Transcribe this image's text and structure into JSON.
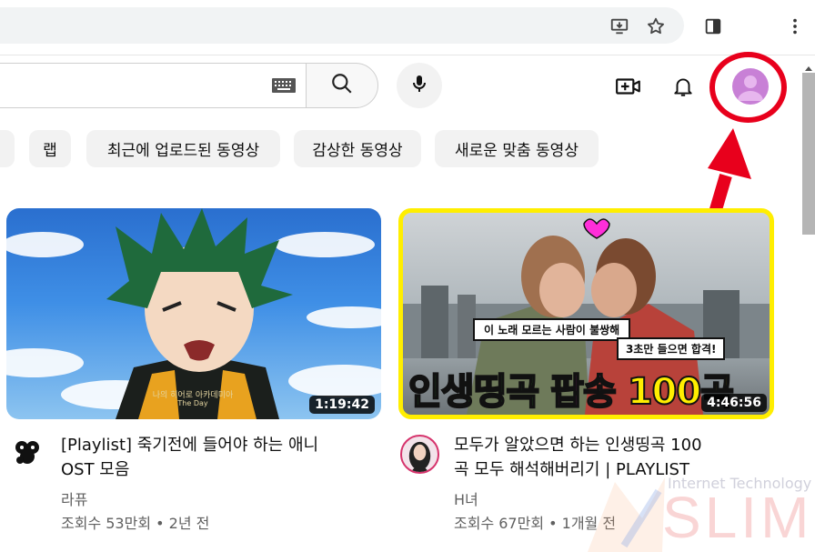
{
  "colors": {
    "annotation_red": "#e8001c",
    "chip_bg": "#f2f2f2",
    "meta_gray": "#606060",
    "thumb2_border": "#ffee00"
  },
  "browser": {
    "icons": [
      "install-app-icon",
      "bookmark-star-icon",
      "side-panel-icon",
      "more-vert-icon"
    ]
  },
  "header": {
    "icons": [
      "keyboard-icon",
      "search-icon",
      "mic-icon",
      "create-video-icon",
      "notifications-bell-icon",
      "account-avatar-icon"
    ]
  },
  "chips": [
    {
      "label": "랩"
    },
    {
      "label": "최근에 업로드된 동영상"
    },
    {
      "label": "감상한 동영상"
    },
    {
      "label": "새로운 맞춤 동영상"
    }
  ],
  "videos": [
    {
      "title_line1": "[Playlist] 죽기전에 들어야 하는 애니",
      "title_line2": "OST 모음",
      "channel": "라퓨",
      "stats": "조회수 53만회 • 2년 전",
      "duration": "1:19:42",
      "thumb_caption_top": "나의 히어로 아카데미아",
      "thumb_caption_bottom": "The Day"
    },
    {
      "title_line1": "모두가 알았으면 하는 인생띵곡 100",
      "title_line2": "곡 모두 해석해버리기 | PLAYLIST",
      "channel": "H녀",
      "stats": "조회수 67만회 • 1개월 전",
      "duration": "4:46:56",
      "thumb_bubble1": "이 노래 모르는 사람이 불쌍해",
      "thumb_bubble2": "3초만 들으면 합격!",
      "thumb_headline_a": "인생띵곡",
      "thumb_headline_b": "팝송",
      "thumb_headline_c": "100곡"
    }
  ],
  "watermark": {
    "line1": "Internet Technology",
    "line2": "SLIM"
  }
}
